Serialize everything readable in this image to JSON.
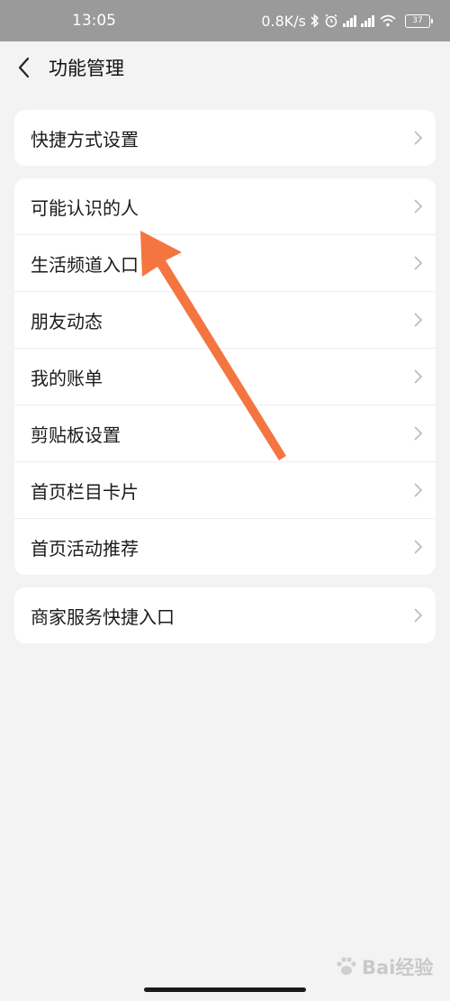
{
  "status_bar": {
    "time": "13:05",
    "network_speed": "0.8K/s",
    "signal_1_label": "4G",
    "signal_2_label": "4G",
    "battery": "37"
  },
  "header": {
    "title": "功能管理"
  },
  "groups": [
    {
      "items": [
        {
          "label": "快捷方式设置"
        }
      ]
    },
    {
      "items": [
        {
          "label": "可能认识的人"
        },
        {
          "label": "生活频道入口"
        },
        {
          "label": "朋友动态"
        },
        {
          "label": "我的账单"
        },
        {
          "label": "剪贴板设置"
        },
        {
          "label": "首页栏目卡片"
        },
        {
          "label": "首页活动推荐"
        }
      ]
    },
    {
      "items": [
        {
          "label": "商家服务快捷入口"
        }
      ]
    }
  ],
  "annotation": {
    "color": "#f57540"
  },
  "watermark": {
    "text": "Bai经验"
  }
}
